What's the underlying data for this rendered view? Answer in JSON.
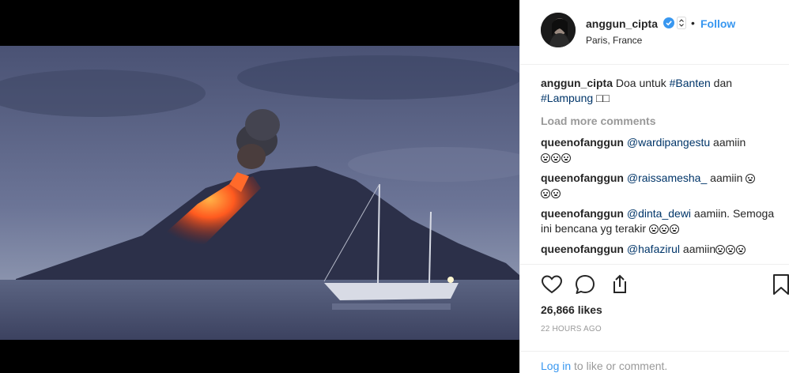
{
  "post": {
    "image_alt": "Volcano erupting at dusk with sailboat",
    "author": {
      "username": "anggun_cipta",
      "location": "Paris, France",
      "follow_label": "Follow",
      "separator": "•",
      "verified_icon": "verified-badge-icon"
    },
    "caption": {
      "username": "anggun_cipta",
      "text_before": "Doa untuk ",
      "tag1": "#Banten",
      "text_middle": " dan",
      "tag2": "#Lampung",
      "text_after": " □□"
    },
    "load_more_label": "Load more comments",
    "comments": [
      {
        "username": "queenofanggun",
        "mention": "@wardipangestu",
        "text": " aamiin",
        "emoji_count": 3
      },
      {
        "username": "queenofanggun",
        "mention": "@raissamesha_",
        "text": " aamiin ",
        "emoji_count": 3
      },
      {
        "username": "queenofanggun",
        "mention": "@dinta_dewi",
        "text": " aamiin. Semoga ini bencana yg terakir ",
        "emoji_count": 3
      },
      {
        "username": "queenofanggun",
        "mention": "@hafazirul",
        "text": " aamiin",
        "emoji_count": 3
      }
    ],
    "likes_label": "26,866 likes",
    "time_label": "22 HOURS AGO",
    "footer": {
      "login_link": "Log in",
      "login_rest": " to like or comment."
    },
    "icons": [
      "heart-icon",
      "comment-icon",
      "share-icon",
      "bookmark-icon"
    ],
    "colors": {
      "link": "#3897f0",
      "tag": "#003569",
      "muted": "#999999",
      "text": "#262626"
    }
  }
}
